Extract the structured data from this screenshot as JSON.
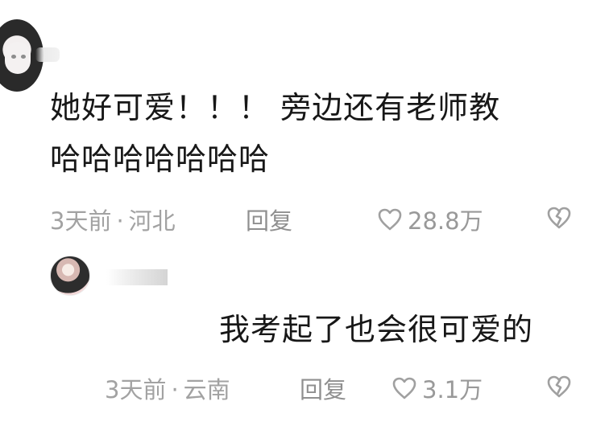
{
  "comment": {
    "text": "她好可爱！！！ 旁边还有老师教\n哈哈哈哈哈哈哈",
    "time": "3天前",
    "separator": "·",
    "location": "河北",
    "reply_label": "回复",
    "likes": "28.8万"
  },
  "reply": {
    "text": "我考起了也会很可爱的",
    "time": "3天前",
    "separator": "·",
    "location": "云南",
    "reply_label": "回复",
    "likes": "3.1万"
  },
  "icons": {
    "like": "heart-icon",
    "dislike": "broken-heart-icon"
  },
  "colors": {
    "text": "#171717",
    "meta": "#a2a2a2",
    "background": "#ffffff"
  }
}
